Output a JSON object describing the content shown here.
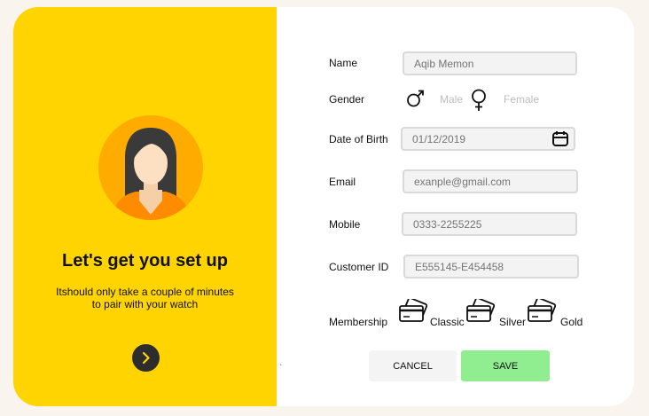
{
  "welcome": {
    "title": "Let's get you set up",
    "subtitle_line1": "Itshould only take a couple of minutes",
    "subtitle_line2": "to pair with your watch"
  },
  "form": {
    "name": {
      "label": "Name",
      "placeholder": "Aqib Memon"
    },
    "gender": {
      "label": "Gender",
      "male": "Male",
      "female": "Female"
    },
    "dob": {
      "label": "Date of Birth",
      "placeholder": "01/12/2019"
    },
    "email": {
      "label": "Email",
      "placeholder": "exanple@gmail.com"
    },
    "mobile": {
      "label": "Mobile",
      "placeholder": "0333-2255225"
    },
    "customer_id": {
      "label": "Customer ID",
      "placeholder": "E555145-E454458"
    },
    "membership": {
      "label": "Membership",
      "options": [
        "Classic",
        "Silver",
        "Gold"
      ]
    }
  },
  "actions": {
    "cancel": "CANCEL",
    "save": "SAVE"
  },
  "stray_mark": "`",
  "colors": {
    "left_panel": "#ffd400",
    "avatar_bg": "#ffab00",
    "save_button": "#90ee90",
    "next_button": "#2d2d2d"
  },
  "icons": {
    "male": "male-symbol-icon",
    "female": "female-symbol-icon",
    "calendar": "calendar-icon",
    "card": "credit-card-icon",
    "next": "chevron-right-icon"
  }
}
